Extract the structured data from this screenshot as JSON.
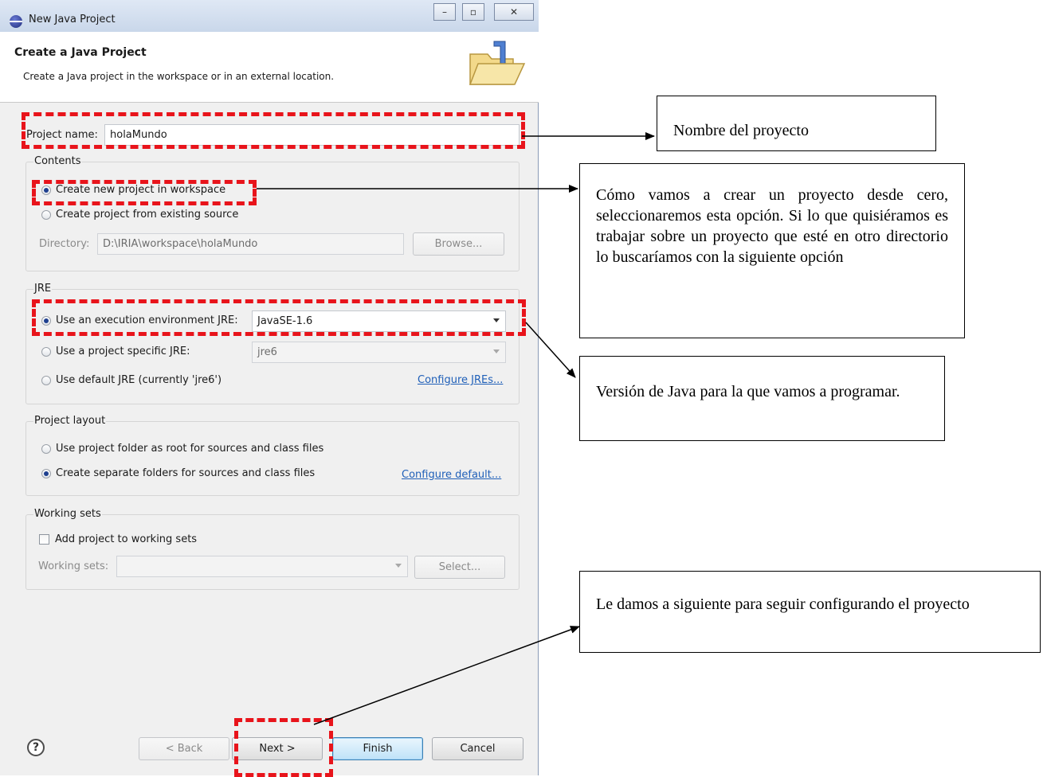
{
  "window": {
    "title": "New Java Project",
    "controls": {
      "minimize": "–",
      "maximize": "▫",
      "close": "✕"
    }
  },
  "header": {
    "title": "Create a Java Project",
    "description": "Create a Java project in the workspace or in an external location."
  },
  "project_name": {
    "label": "Project name:",
    "value": "holaMundo"
  },
  "contents": {
    "group_label": "Contents",
    "option_new": "Create new project in workspace",
    "option_existing": "Create project from existing source",
    "directory_label": "Directory:",
    "directory_value": "D:\\IRIA\\workspace\\holaMundo",
    "browse_label": "Browse..."
  },
  "jre": {
    "group_label": "JRE",
    "option_env": "Use an execution environment JRE:",
    "env_value": "JavaSE-1.6",
    "option_specific": "Use a project specific JRE:",
    "specific_value": "jre6",
    "option_default": "Use default JRE (currently 'jre6')",
    "configure_link": "Configure JREs..."
  },
  "layout": {
    "group_label": "Project layout",
    "option_root": "Use project folder as root for sources and class files",
    "option_separate": "Create separate folders for sources and class files",
    "configure_link": "Configure default..."
  },
  "working_sets": {
    "group_label": "Working sets",
    "add_label": "Add project to working sets",
    "sets_label": "Working sets:",
    "select_label": "Select..."
  },
  "buttons": {
    "help": "?",
    "back": "< Back",
    "next": "Next >",
    "finish": "Finish",
    "cancel": "Cancel"
  },
  "annotations": {
    "name": "Nombre del proyecto",
    "workspace": "Cómo vamos a crear un proyecto desde cero, seleccionaremos esta opción. Si lo que quisiéramos es trabajar sobre un proyecto que esté en otro directorio lo buscaríamos con la siguiente opción",
    "version": "Versión de Java para la que vamos a programar.",
    "next": "Le damos a siguiente para seguir configurando el proyecto"
  },
  "colors": {
    "highlight": "#e8141b",
    "link": "#1f5fb8"
  },
  "icons": {
    "title": "eclipse-icon",
    "header": "java-folder-icon",
    "help": "help-icon"
  }
}
